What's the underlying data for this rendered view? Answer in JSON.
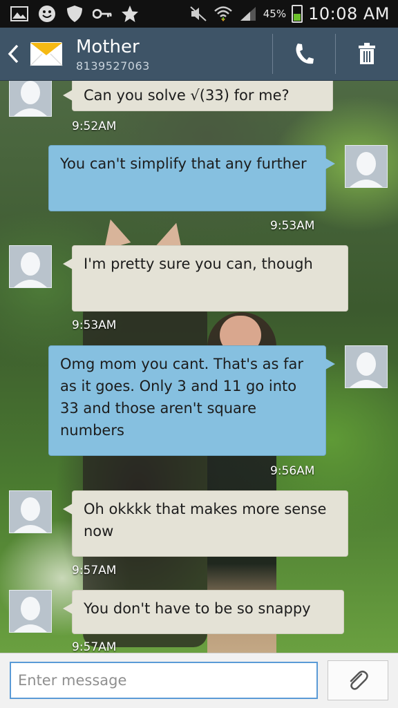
{
  "status_bar": {
    "battery_percent": "45%",
    "time": "10:08 AM",
    "battery_level": 0.45,
    "icons": [
      "gallery-icon",
      "smiley-icon",
      "shield-icon",
      "key-icon",
      "star-icon",
      "mute-icon",
      "wifi-icon",
      "signal-icon",
      "battery-icon"
    ]
  },
  "header": {
    "contact_name": "Mother",
    "contact_number": "8139527063",
    "icons": [
      "back-icon",
      "envelope-icon",
      "phone-icon",
      "trash-icon"
    ]
  },
  "messages": [
    {
      "direction": "in",
      "text": "Can you solve √(33) for me?",
      "time": "9:52AM"
    },
    {
      "direction": "out",
      "text": "You can't simplify that any further",
      "time": "9:53AM"
    },
    {
      "direction": "in",
      "text": "I'm pretty sure you can, though",
      "time": "9:53AM"
    },
    {
      "direction": "out",
      "text": "Omg mom you cant. That's as far as it goes. Only 3 and 11 go into 33 and those aren't square numbers",
      "time": "9:56AM"
    },
    {
      "direction": "in",
      "text": "Oh okkkk that makes more sense now",
      "time": "9:57AM"
    },
    {
      "direction": "in",
      "text": "You don't have to be so snappy",
      "time": "9:57AM"
    }
  ],
  "composer": {
    "placeholder": "Enter message",
    "attach_icon": "paperclip-icon"
  },
  "colors": {
    "incoming_bubble": "#e4e2d6",
    "outgoing_bubble": "#86c0e0",
    "action_bar": "#3e5467",
    "input_border": "#5a9ad6"
  }
}
